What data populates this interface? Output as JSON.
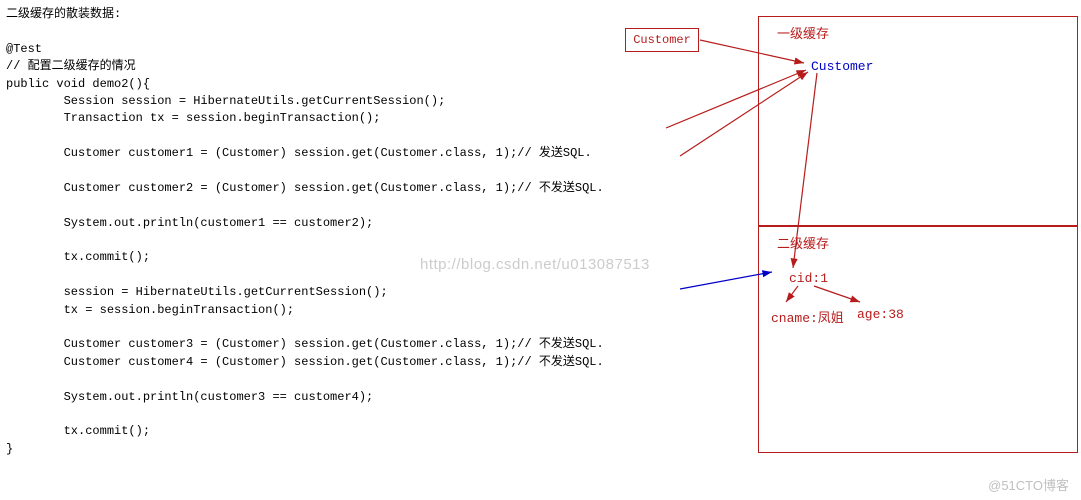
{
  "title": "二级缓存的散装数据:",
  "code": "@Test\n// 配置二级缓存的情况\npublic void demo2(){\n        Session session = HibernateUtils.getCurrentSession();\n        Transaction tx = session.beginTransaction();\n\n        Customer customer1 = (Customer) session.get(Customer.class, 1);// 发送SQL.\n\n        Customer customer2 = (Customer) session.get(Customer.class, 1);// 不发送SQL.\n\n        System.out.println(customer1 == customer2);\n\n        tx.commit();\n\n        session = HibernateUtils.getCurrentSession();\n        tx = session.beginTransaction();\n\n        Customer customer3 = (Customer) session.get(Customer.class, 1);// 不发送SQL.\n        Customer customer4 = (Customer) session.get(Customer.class, 1);// 不发送SQL.\n\n        System.out.println(customer3 == customer4);\n\n        tx.commit();\n}",
  "customer_box": "Customer",
  "l1": {
    "title": "一级缓存",
    "customer": "Customer"
  },
  "l2": {
    "title": "二级缓存",
    "cid": "cid:1",
    "cname": "cname:凤姐",
    "age": "age:38"
  },
  "watermark_csdn": "http://blog.csdn.net/u013087513",
  "watermark_51cto": "@51CTO博客"
}
